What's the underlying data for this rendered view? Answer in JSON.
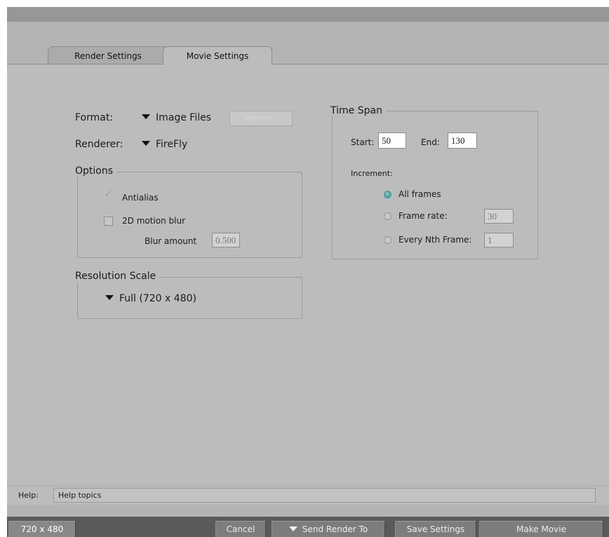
{
  "tabs": [
    {
      "label": "Render Settings",
      "active": false
    },
    {
      "label": "Movie Settings",
      "active": true
    }
  ],
  "format": {
    "label": "Format:",
    "value": "Image Files",
    "options_button": "Options..."
  },
  "renderer": {
    "label": "Renderer:",
    "value": "FireFly"
  },
  "options_group": {
    "title": "Options",
    "antialias": {
      "label": "Antialias",
      "checked": true,
      "enabled": false
    },
    "motion_blur": {
      "label": "2D motion blur",
      "checked": false
    },
    "blur_amount": {
      "label": "Blur amount",
      "value": "0.500"
    }
  },
  "resolution_scale": {
    "title": "Resolution Scale",
    "value": "Full (720 x 480)"
  },
  "time_span": {
    "title": "Time Span",
    "start_label": "Start:",
    "start_value": "50",
    "end_label": "End:",
    "end_value": "130",
    "increment_label": "Increment:",
    "options": [
      {
        "label": "All frames",
        "selected": true
      },
      {
        "label": "Frame rate:",
        "selected": false,
        "value": "30"
      },
      {
        "label": "Every Nth Frame:",
        "selected": false,
        "value": "1"
      }
    ]
  },
  "help": {
    "label": "Help:",
    "value": "Help topics"
  },
  "bottom": {
    "resolution": "720 x 480",
    "cancel": "Cancel",
    "send_render_to": "Send Render To",
    "save_settings": "Save Settings",
    "make_movie": "Make Movie"
  },
  "colors": {
    "radio_selected": "#3e9a9e",
    "panel_bg": "#bcbcbc",
    "bottom_bar": "#5a5a5a"
  }
}
